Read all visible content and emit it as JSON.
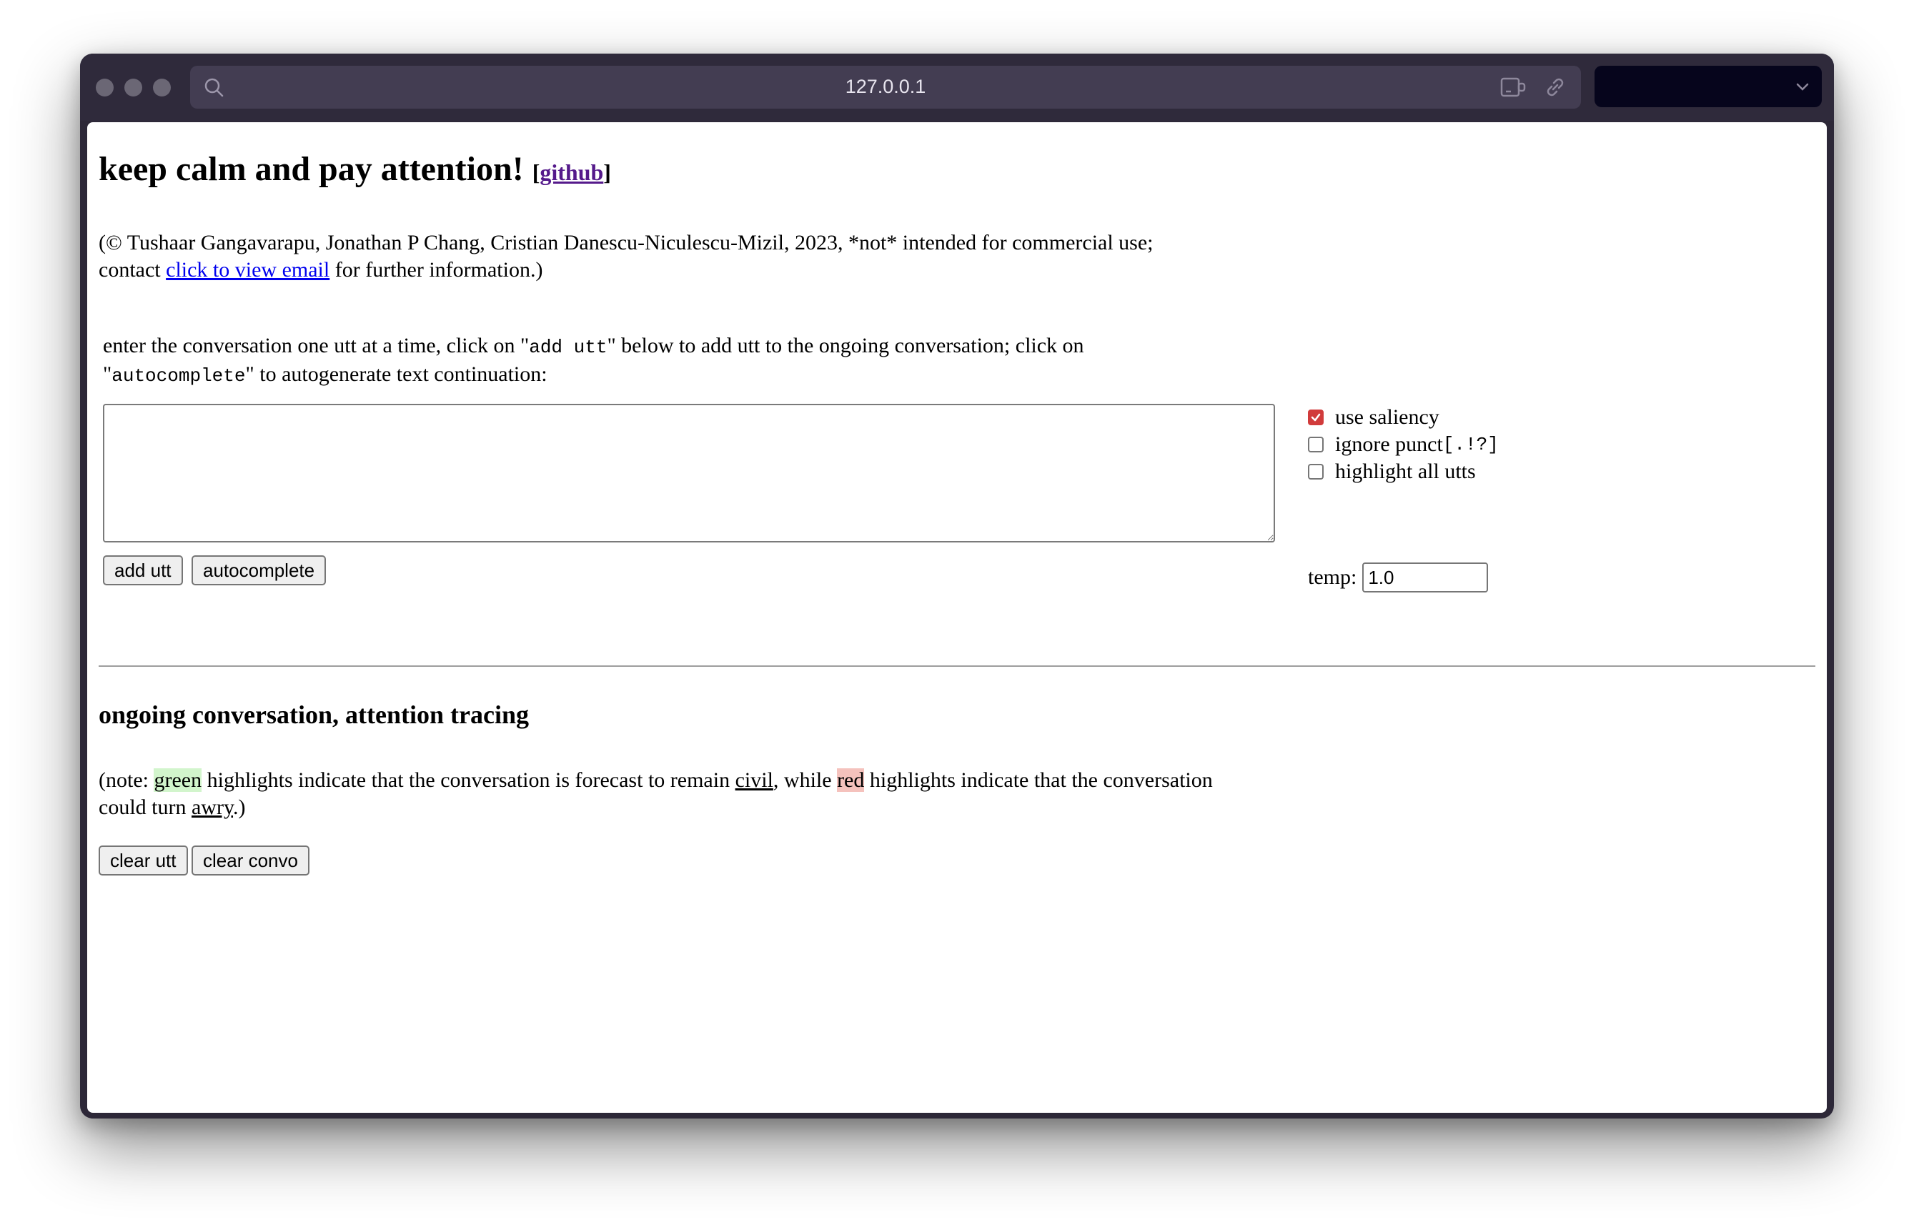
{
  "browser": {
    "url": "127.0.0.1"
  },
  "header": {
    "title": "keep calm and pay attention!",
    "github_open": "[",
    "github_label": "github",
    "github_close": "]"
  },
  "credits": {
    "line1": "(© Tushaar Gangavarapu, Jonathan P Chang, Cristian Danescu-Niculescu-Mizil, 2023, *not* intended for commercial use;",
    "line2_prefix": "contact ",
    "email_link": "click to view email",
    "line2_suffix": " for further information.)"
  },
  "instructions": {
    "part1": "enter the conversation one utt at a time, click on \"",
    "code1": "add utt",
    "part2": "\" below to add utt to the ongoing conversation; click on",
    "part3": "\"",
    "code2": "autocomplete",
    "part4": "\" to autogenerate text continuation:"
  },
  "input": {
    "utterance_value": "",
    "add_button": "add utt",
    "autocomplete_button": "autocomplete"
  },
  "options": {
    "use_saliency": {
      "label": "use saliency",
      "checked": true
    },
    "ignore_punct": {
      "label": "ignore punct ",
      "code": "[.!?]",
      "checked": false
    },
    "highlight_all": {
      "label": "highlight all utts",
      "checked": false
    },
    "temp_label": "temp:",
    "temp_value": "1.0"
  },
  "conversation": {
    "heading": "ongoing conversation, attention tracing",
    "note_open": "(note: ",
    "green": "green",
    "note_mid1": " highlights indicate that the conversation is forecast to remain ",
    "civil": "civil",
    "note_mid2": ", while ",
    "red": "red",
    "note_mid3": " highlights indicate that the conversation",
    "note_line2_prefix": "could turn ",
    "awry": "awry",
    "note_close": ".)",
    "clear_utt_button": "clear utt",
    "clear_convo_button": "clear convo"
  },
  "colors": {
    "green_highlight": "#d2f5cc",
    "red_highlight": "#f5c2bd",
    "checkbox_accent": "#d13b3b"
  }
}
